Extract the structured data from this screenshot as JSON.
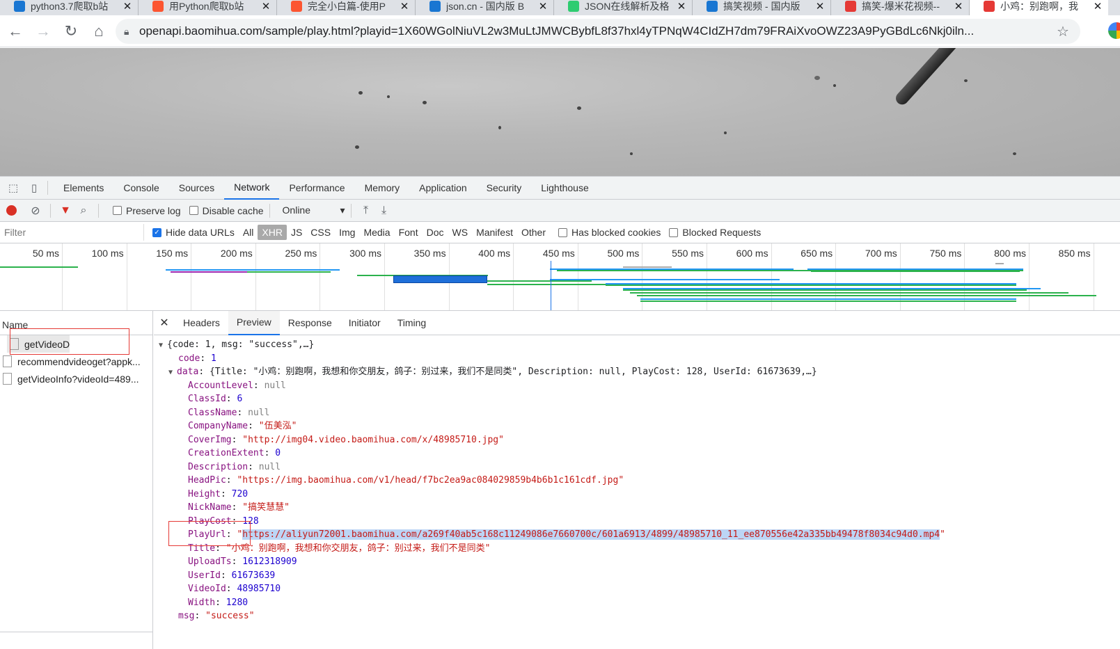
{
  "browser": {
    "tabs": [
      {
        "title": "python3.7爬取b站",
        "icon": "bing-icon",
        "color": "#1976d2"
      },
      {
        "title": "用Python爬取b站",
        "icon": "csdn-icon",
        "color": "#fc5531"
      },
      {
        "title": "完全小白篇-使用P",
        "icon": "csdn-icon",
        "color": "#fc5531"
      },
      {
        "title": "json.cn - 国内版 B",
        "icon": "bing-icon",
        "color": "#1976d2"
      },
      {
        "title": "JSON在线解析及格",
        "icon": "json-icon",
        "color": "#2ecc71"
      },
      {
        "title": "搞笑视频 - 国内版",
        "icon": "bing-icon",
        "color": "#1976d2"
      },
      {
        "title": "搞笑-爆米花视频--",
        "icon": "baomihua-icon",
        "color": "#e53935"
      },
      {
        "title": "小鸡：别跑啊，我",
        "icon": "baomihua-icon",
        "color": "#e53935"
      }
    ],
    "url": "openapi.baomihua.com/sample/play.html?playid=1X60WGolNiuVL2w3MuLtJMWCBybfL8f37hxl4yTPNqW4CIdZH7dm79FRAiXvoOWZ23A9PyGBdLc6Nkj0iln..."
  },
  "devtools": {
    "tabs": [
      "Elements",
      "Console",
      "Sources",
      "Network",
      "Performance",
      "Memory",
      "Application",
      "Security",
      "Lighthouse"
    ],
    "active_tab": "Network",
    "netbar": {
      "preserve_log": "Preserve log",
      "disable_cache": "Disable cache",
      "throttle": "Online"
    },
    "filter": {
      "placeholder": "Filter",
      "hide_data_urls": "Hide data URLs",
      "types": [
        "All",
        "XHR",
        "JS",
        "CSS",
        "Img",
        "Media",
        "Font",
        "Doc",
        "WS",
        "Manifest",
        "Other"
      ],
      "active_type": "XHR",
      "has_blocked_cookies": "Has blocked cookies",
      "blocked_requests": "Blocked Requests"
    },
    "timeline": {
      "ticks": [
        "50 ms",
        "100 ms",
        "150 ms",
        "200 ms",
        "250 ms",
        "300 ms",
        "350 ms",
        "400 ms",
        "450 ms",
        "500 ms",
        "550 ms",
        "600 ms",
        "650 ms",
        "700 ms",
        "750 ms",
        "800 ms",
        "850 ms"
      ]
    },
    "requests": {
      "header": "Name",
      "items": [
        "getVideoDetailP",
        "recommendvideoget?appk...",
        "getVideoInfo?videoId=489..."
      ]
    },
    "detail_tabs": [
      "Headers",
      "Preview",
      "Response",
      "Initiator",
      "Timing"
    ],
    "active_detail_tab": "Preview",
    "preview": {
      "root_summary": "{code: 1, msg: \"success\",…}",
      "code": "1",
      "data_summary": "{Title: \"小鸡：别跑啊，我想和你交朋友，鸽子：别过来，我们不是同类\", Description: null, PlayCost: 128, UserId: 61673639,…}",
      "fields": [
        {
          "key": "AccountLevel",
          "value": "null",
          "type": "nul"
        },
        {
          "key": "ClassId",
          "value": "6",
          "type": "num"
        },
        {
          "key": "ClassName",
          "value": "null",
          "type": "nul"
        },
        {
          "key": "CompanyName",
          "value": "\"伍美泓\"",
          "type": "str"
        },
        {
          "key": "CoverImg",
          "value": "\"http://img04.video.baomihua.com/x/48985710.jpg\"",
          "type": "str"
        },
        {
          "key": "CreationExtent",
          "value": "0",
          "type": "num"
        },
        {
          "key": "Description",
          "value": "null",
          "type": "nul"
        },
        {
          "key": "HeadPic",
          "value": "\"https://img.baomihua.com/v1/head/f7bc2ea9ac084029859b4b6b1c161cdf.jpg\"",
          "type": "str"
        },
        {
          "key": "Height",
          "value": "720",
          "type": "num"
        },
        {
          "key": "NickName",
          "value": "\"搞笑慧慧\"",
          "type": "str"
        },
        {
          "key": "PlayCost",
          "value": "128",
          "type": "num"
        },
        {
          "key": "PlayUrl",
          "value": "https://aliyun72001.baomihua.com/a269f40ab5c168c11249086e7660700c/601a6913/4899/48985710_11_ee870556e42a335bb49478f8034c94d0.mp4",
          "type": "url"
        },
        {
          "key": "Title",
          "value": "\"小鸡：别跑啊，我想和你交朋友，鸽子：别过来，我们不是同类\"",
          "type": "str"
        },
        {
          "key": "UploadTs",
          "value": "1612318909",
          "type": "num"
        },
        {
          "key": "UserId",
          "value": "61673639",
          "type": "num"
        },
        {
          "key": "VideoId",
          "value": "48985710",
          "type": "num"
        },
        {
          "key": "Width",
          "value": "1280",
          "type": "num"
        }
      ],
      "msg": "\"success\""
    }
  }
}
